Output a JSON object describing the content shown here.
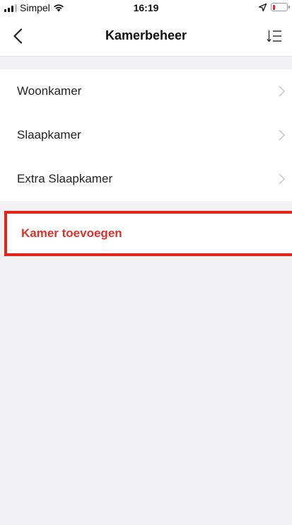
{
  "status_bar": {
    "carrier": "Simpel",
    "time": "16:19",
    "battery_level": 0.15,
    "battery_color": "#e2282b",
    "icons": [
      "signal-icon",
      "wifi-icon",
      "location-arrow-icon",
      "battery-icon"
    ]
  },
  "nav": {
    "title": "Kamerbeheer",
    "back_icon": "chevron-left-icon",
    "sort_icon": "sort-list-icon"
  },
  "rooms": [
    {
      "label": "Woonkamer"
    },
    {
      "label": "Slaapkamer"
    },
    {
      "label": "Extra Slaapkamer"
    }
  ],
  "add_room": {
    "label": "Kamer toevoegen",
    "color": "#e0312b",
    "highlight_color": "#e2251b"
  }
}
